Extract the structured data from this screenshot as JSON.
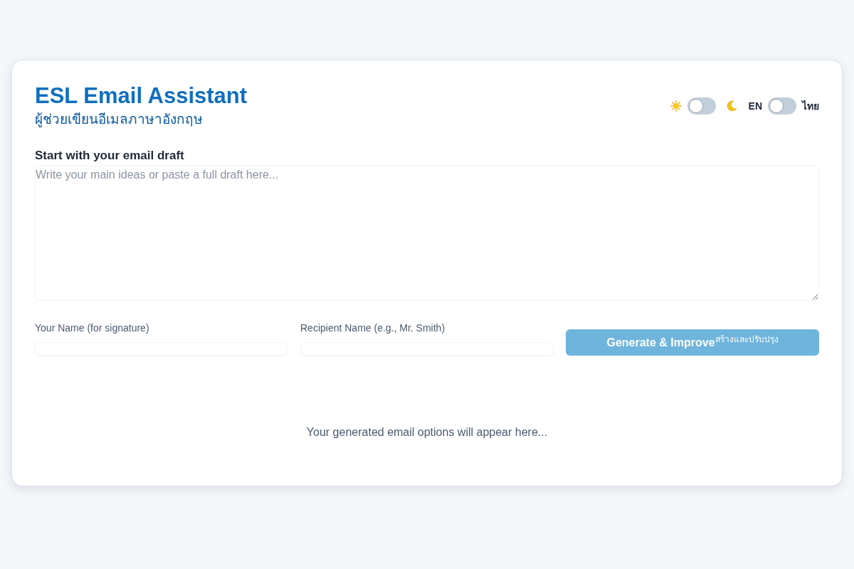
{
  "header": {
    "title": "ESL Email Assistant",
    "subtitle": "ผู้ช่วยเขียนอีเมลภาษาอังกฤษ"
  },
  "toggles": {
    "theme": {
      "on": false
    },
    "language": {
      "left_label": "EN",
      "right_label": "ไทย",
      "on": false
    }
  },
  "draft": {
    "label": "Start with your email draft",
    "placeholder": "Write your main ideas or paste a full draft here..."
  },
  "fields": [
    {
      "label": "Your Name (for signature)"
    },
    {
      "label": "Recipient Name (e.g., Mr. Smith)"
    }
  ],
  "generate_button": {
    "label": "Generate & Improve",
    "label_thai": "สร้างและปรับปรุง",
    "disabled": true
  },
  "results": {
    "empty_message": "Your generated email options will appear here..."
  }
}
